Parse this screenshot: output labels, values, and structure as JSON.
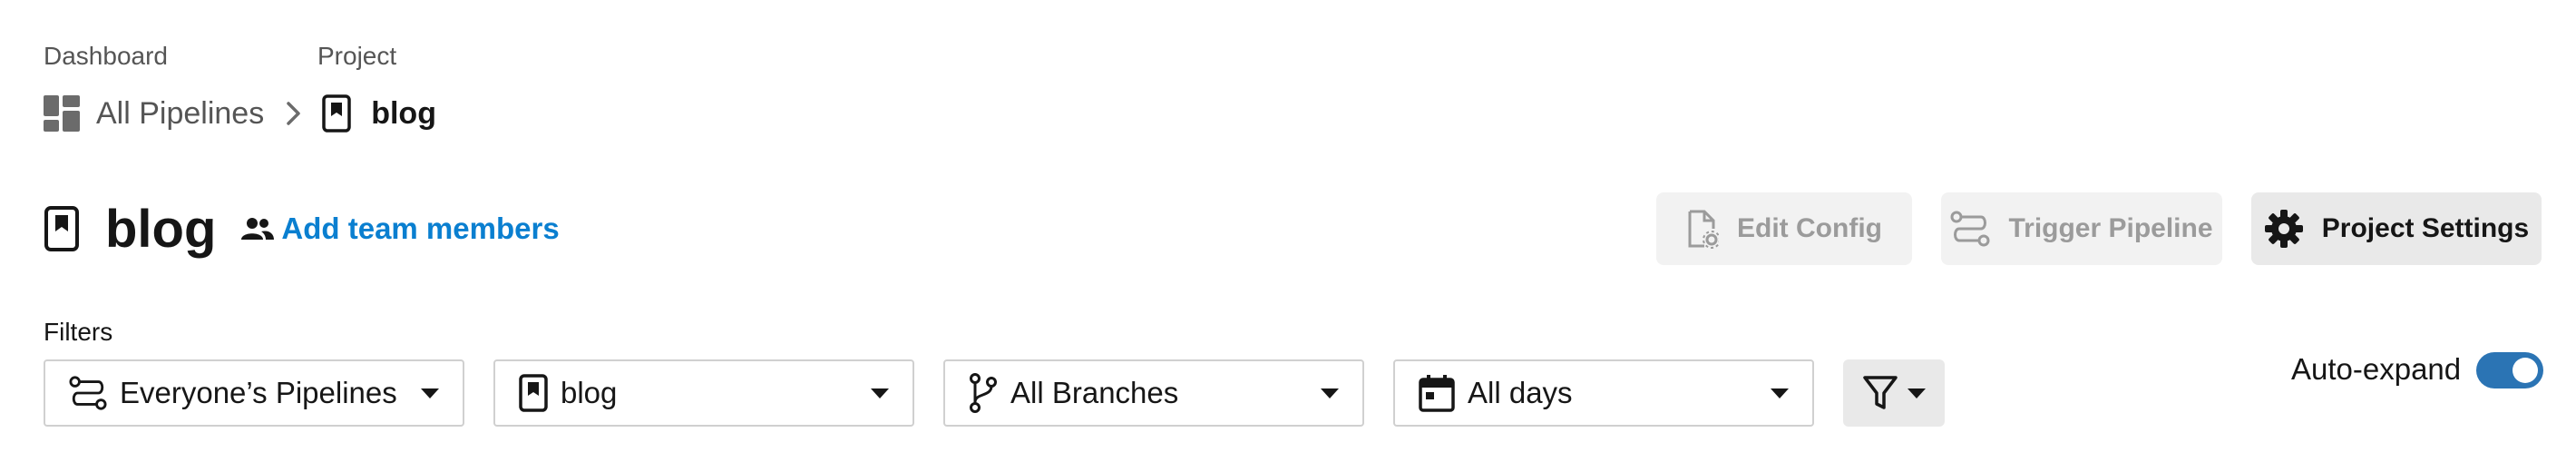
{
  "breadcrumb": {
    "dashboard_label": "Dashboard",
    "project_label": "Project",
    "all_pipelines": "All Pipelines",
    "project_name": "blog"
  },
  "header": {
    "title": "blog",
    "add_team_members": "Add team members"
  },
  "actions": {
    "edit_config": "Edit Config",
    "trigger_pipeline": "Trigger Pipeline",
    "project_settings": "Project Settings"
  },
  "filters": {
    "label": "Filters",
    "pipelines": "Everyone’s Pipelines",
    "project": "blog",
    "branches": "All Branches",
    "days": "All days"
  },
  "auto_expand": {
    "label": "Auto-expand",
    "enabled": true
  },
  "colors": {
    "link": "#0a7fd0",
    "toggle_on": "#2b74b4",
    "text": "#161616",
    "muted": "#555555"
  },
  "icons": {
    "dashboard": "dashboard-icon",
    "chevron": "chevron-right-icon",
    "project": "project-bookmark-icon",
    "team": "people-icon",
    "edit_config": "file-gear-icon",
    "trigger": "pipeline-icon",
    "settings": "gear-icon",
    "branch": "git-branch-icon",
    "calendar": "calendar-icon",
    "filter": "funnel-icon"
  }
}
